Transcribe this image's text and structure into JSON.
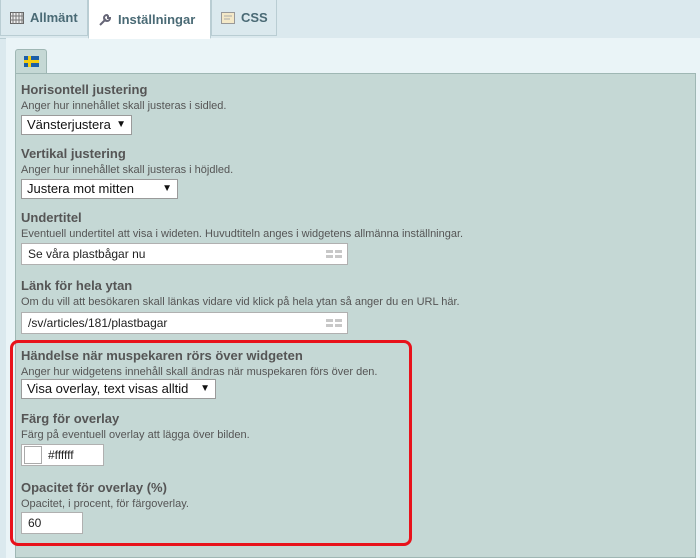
{
  "tabs": [
    {
      "label": "Allmänt",
      "icon": "grid-icon",
      "active": false
    },
    {
      "label": "Inställningar",
      "icon": "wrench-icon",
      "active": true
    },
    {
      "label": "CSS",
      "icon": "css-icon",
      "active": false
    }
  ],
  "language_tab": {
    "icon": "swedish-flag-icon"
  },
  "fields": {
    "horizontal": {
      "title": "Horisontell justering",
      "description": "Anger hur innehållet skall justeras i sidled.",
      "value": "Vänsterjustera"
    },
    "vertical": {
      "title": "Vertikal justering",
      "description": "Anger hur innehållet skall justeras i höjdled.",
      "value": "Justera mot mitten"
    },
    "subtitle": {
      "title": "Undertitel",
      "description": "Eventuell undertitel att visa i wideten. Huvudtiteln anges i widgetens allmänna inställningar.",
      "value": "Se våra plastbågar nu"
    },
    "link": {
      "title": "Länk för hela ytan",
      "description": "Om du vill att besökaren skall länkas vidare vid klick på hela ytan så anger du en URL här.",
      "value": "/sv/articles/181/plastbagar"
    },
    "hover": {
      "title": "Händelse när muspekaren rörs över widgeten",
      "description": "Anger hur widgetens innehåll skall ändras när muspekaren förs över den.",
      "value": "Visa overlay, text visas alltid"
    },
    "overlay_color": {
      "title": "Färg för overlay",
      "description": "Färg på eventuell overlay att lägga över bilden.",
      "value": "#ffffff"
    },
    "overlay_opacity": {
      "title": "Opacitet för overlay (%)",
      "description": "Opacitet, i procent, för färgoverlay.",
      "value": "60"
    }
  },
  "colors": {
    "highlight": "#e8121b",
    "panel": "#c5d8d5"
  }
}
